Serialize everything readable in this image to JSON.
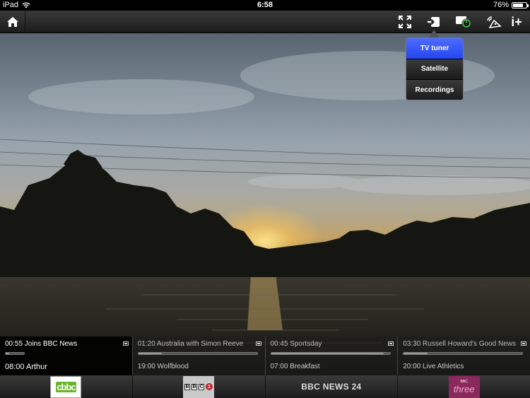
{
  "status_bar": {
    "device": "iPad",
    "time": "6:58",
    "battery_percent": "76%",
    "battery_level": 0.76
  },
  "toolbar": {
    "icons": [
      "home-icon",
      "fullscreen-icon",
      "source-input-icon",
      "power-icon",
      "remote-icon",
      "info-plus-icon"
    ],
    "info_label": "i+"
  },
  "source_menu": {
    "items": [
      "TV tuner",
      "Satellite",
      "Recordings"
    ],
    "selected": "TV tuner",
    "selected_color": "#3056f5"
  },
  "epg": [
    {
      "now": "00:55 Joins BBC News",
      "progress": 0.18,
      "next": "08:00 Arthur",
      "active": true
    },
    {
      "now": "01:20 Australia with Simon Reeve",
      "progress": 0.2,
      "next": "19:00 Wolfblood",
      "active": false
    },
    {
      "now": "00:45 Sportsday",
      "progress": 0.95,
      "next": "07:00 Breakfast",
      "active": false
    },
    {
      "now": "03:30 Russell Howard's Good News",
      "progress": 0.2,
      "next": "20:00 Live Athletics",
      "active": false
    }
  ],
  "channels": [
    {
      "name": "cbbc",
      "logo": "cbbc-logo"
    },
    {
      "name": "BBC ONE",
      "logo": "bbc-one-logo"
    },
    {
      "name": "BBC NEWS 24",
      "logo": "text"
    },
    {
      "name": "BBC three",
      "logo": "bbc-three-logo"
    }
  ],
  "logos": {
    "cbbc_text": "cbbc",
    "cbbc_sub": "BBC",
    "bbc1_letters": [
      "B",
      "B",
      "C"
    ],
    "bbc1_one": "1",
    "three_small": "BBC",
    "three_big": "three"
  }
}
